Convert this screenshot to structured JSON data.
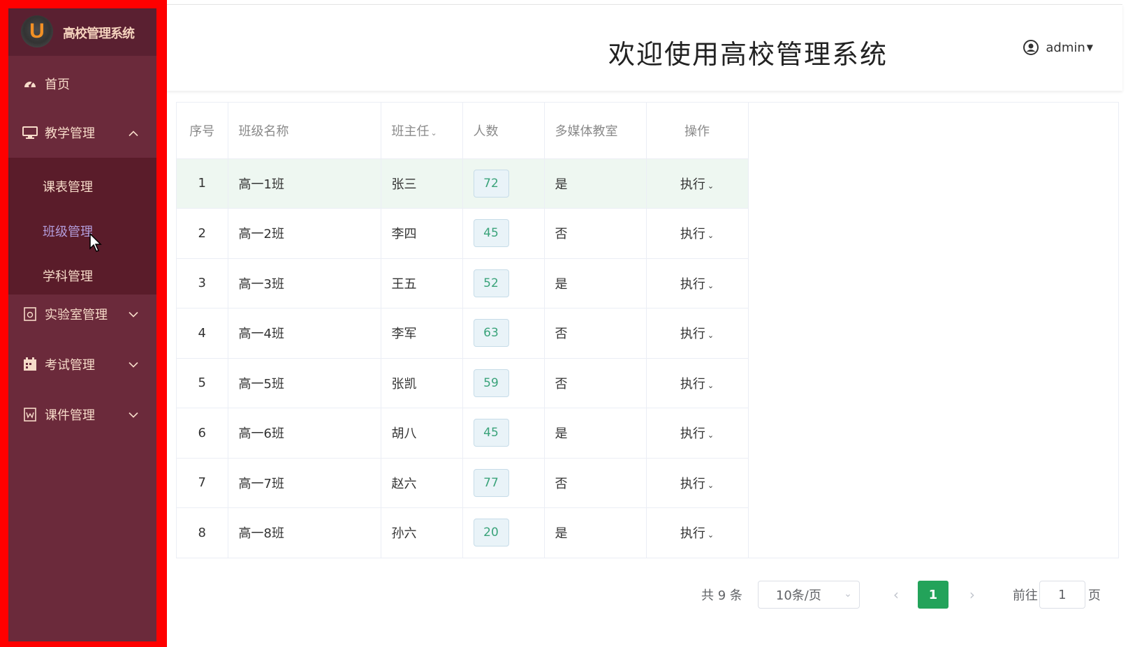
{
  "app": {
    "logo_letter": "U",
    "logo_title": "高校管理系统"
  },
  "sidebar": {
    "items": [
      {
        "label": "首页",
        "icon": "dashboard-icon"
      },
      {
        "label": "教学管理",
        "icon": "monitor-icon",
        "expanded": true
      },
      {
        "label": "实验室管理",
        "icon": "lab-document-icon"
      },
      {
        "label": "考试管理",
        "icon": "calendar-icon"
      },
      {
        "label": "课件管理",
        "icon": "word-file-icon"
      }
    ],
    "submenu": [
      {
        "label": "课表管理"
      },
      {
        "label": "班级管理",
        "active": true
      },
      {
        "label": "学科管理"
      }
    ]
  },
  "header": {
    "title": "欢迎使用高校管理系统",
    "user": "admin"
  },
  "table": {
    "columns": [
      "序号",
      "班级名称",
      "班主任",
      "人数",
      "多媒体教室",
      "操作"
    ],
    "rows": [
      {
        "idx": "1",
        "name": "高一1班",
        "teacher": "张三",
        "count": "72",
        "media": "是",
        "action": "执行"
      },
      {
        "idx": "2",
        "name": "高一2班",
        "teacher": "李四",
        "count": "45",
        "media": "否",
        "action": "执行"
      },
      {
        "idx": "3",
        "name": "高一3班",
        "teacher": "王五",
        "count": "52",
        "media": "是",
        "action": "执行"
      },
      {
        "idx": "4",
        "name": "高一4班",
        "teacher": "李军",
        "count": "63",
        "media": "否",
        "action": "执行"
      },
      {
        "idx": "5",
        "name": "高一5班",
        "teacher": "张凯",
        "count": "59",
        "media": "否",
        "action": "执行"
      },
      {
        "idx": "6",
        "name": "高一6班",
        "teacher": "胡八",
        "count": "45",
        "media": "是",
        "action": "执行"
      },
      {
        "idx": "7",
        "name": "高一7班",
        "teacher": "赵六",
        "count": "77",
        "media": "否",
        "action": "执行"
      },
      {
        "idx": "8",
        "name": "高一8班",
        "teacher": "孙六",
        "count": "20",
        "media": "是",
        "action": "执行"
      }
    ]
  },
  "pagination": {
    "total_text": "共 9 条",
    "page_size": "10条/页",
    "current_page": "1",
    "goto_label": "前往",
    "goto_value": "1",
    "goto_suffix": "页"
  },
  "colors": {
    "sidebar_bg": "#6b2a3b",
    "sidebar_frame": "#ff0000",
    "accent_green": "#23a35a",
    "active_submenu": "#b39ddb"
  }
}
